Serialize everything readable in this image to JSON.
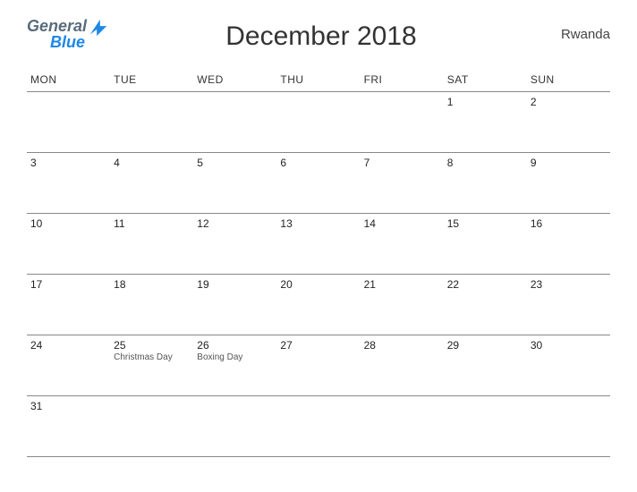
{
  "logo": {
    "line1": "General",
    "line2": "Blue"
  },
  "title": "December 2018",
  "country": "Rwanda",
  "days": [
    "MON",
    "TUE",
    "WED",
    "THU",
    "FRI",
    "SAT",
    "SUN"
  ],
  "weeks": [
    [
      {
        "n": ""
      },
      {
        "n": ""
      },
      {
        "n": ""
      },
      {
        "n": ""
      },
      {
        "n": ""
      },
      {
        "n": "1"
      },
      {
        "n": "2"
      }
    ],
    [
      {
        "n": "3"
      },
      {
        "n": "4"
      },
      {
        "n": "5"
      },
      {
        "n": "6"
      },
      {
        "n": "7"
      },
      {
        "n": "8"
      },
      {
        "n": "9"
      }
    ],
    [
      {
        "n": "10"
      },
      {
        "n": "11"
      },
      {
        "n": "12"
      },
      {
        "n": "13"
      },
      {
        "n": "14"
      },
      {
        "n": "15"
      },
      {
        "n": "16"
      }
    ],
    [
      {
        "n": "17"
      },
      {
        "n": "18"
      },
      {
        "n": "19"
      },
      {
        "n": "20"
      },
      {
        "n": "21"
      },
      {
        "n": "22"
      },
      {
        "n": "23"
      }
    ],
    [
      {
        "n": "24"
      },
      {
        "n": "25",
        "e": "Christmas Day"
      },
      {
        "n": "26",
        "e": "Boxing Day"
      },
      {
        "n": "27"
      },
      {
        "n": "28"
      },
      {
        "n": "29"
      },
      {
        "n": "30"
      }
    ],
    [
      {
        "n": "31"
      },
      {
        "n": ""
      },
      {
        "n": ""
      },
      {
        "n": ""
      },
      {
        "n": ""
      },
      {
        "n": ""
      },
      {
        "n": ""
      }
    ]
  ]
}
